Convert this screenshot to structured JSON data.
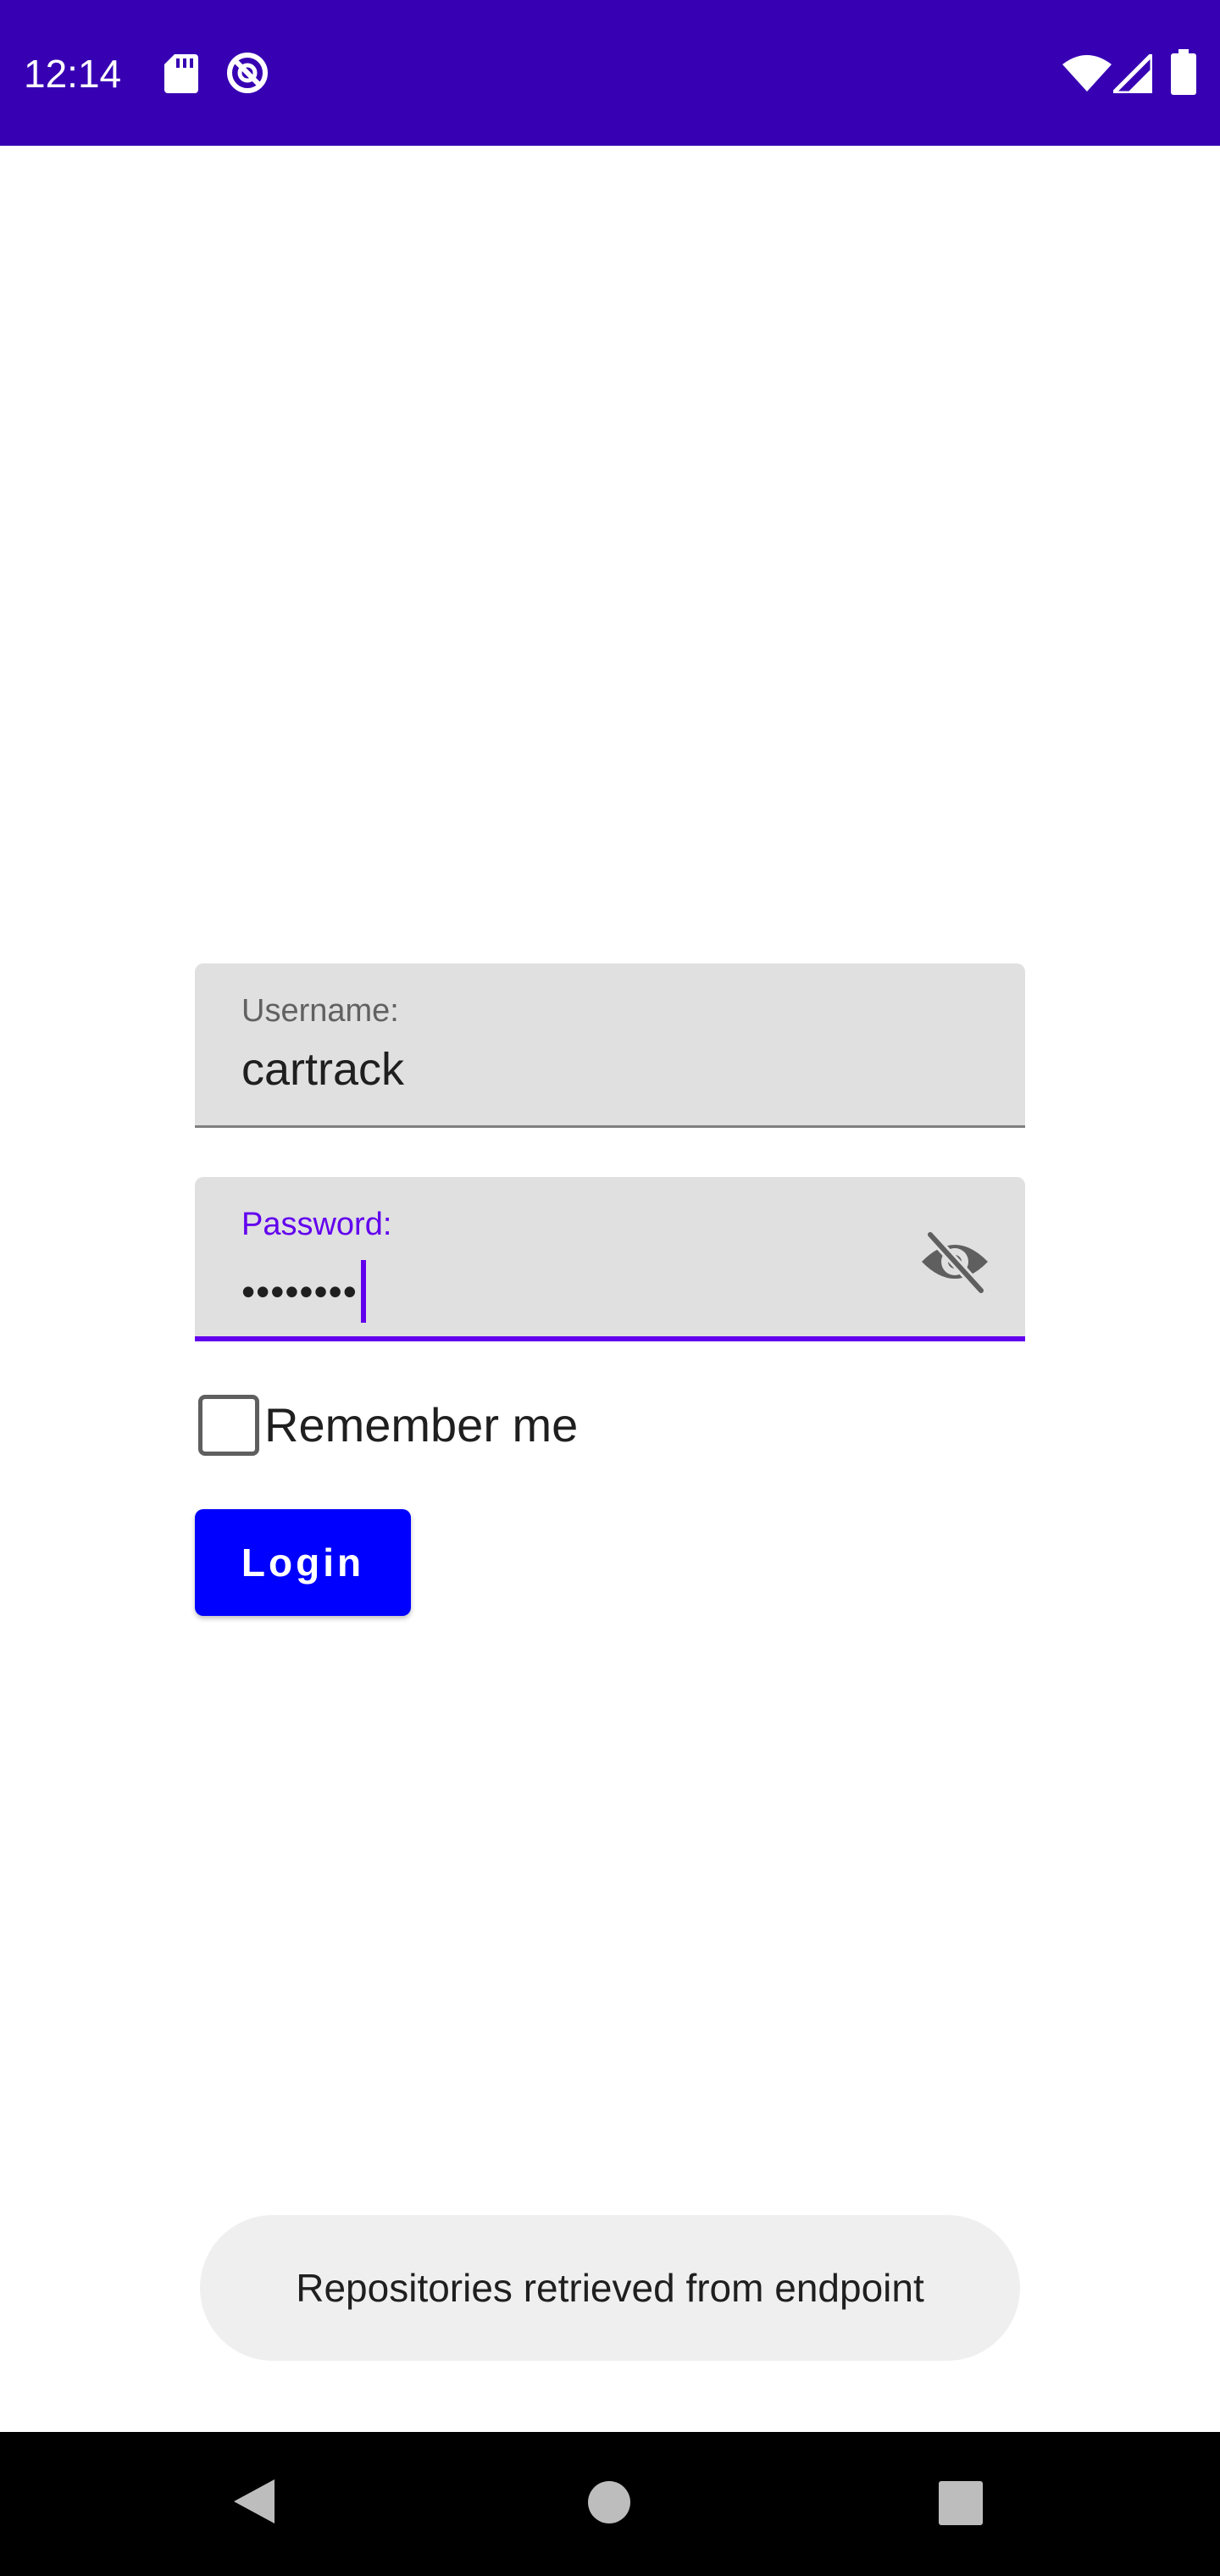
{
  "status_bar": {
    "time": "12:14",
    "background": "#3700b3",
    "left_icons": [
      "sd-card-icon",
      "do-not-disturb-icon"
    ],
    "right_icons": [
      "wifi-icon",
      "cell-signal-icon",
      "battery-icon"
    ]
  },
  "form": {
    "username": {
      "label": "Username:",
      "value": "cartrack"
    },
    "password": {
      "label": "Password:",
      "masked_value": "••••••••",
      "toggle_icon": "visibility-off-icon",
      "accent": "#6200ee"
    },
    "remember_me": {
      "label": "Remember me",
      "checked": false
    },
    "login_button": {
      "label": "Login",
      "color": "#0000ff"
    }
  },
  "toast": {
    "message": "Repositories retrieved from endpoint"
  },
  "nav_bar": {
    "buttons": [
      "back-icon",
      "home-icon",
      "recents-icon"
    ]
  }
}
